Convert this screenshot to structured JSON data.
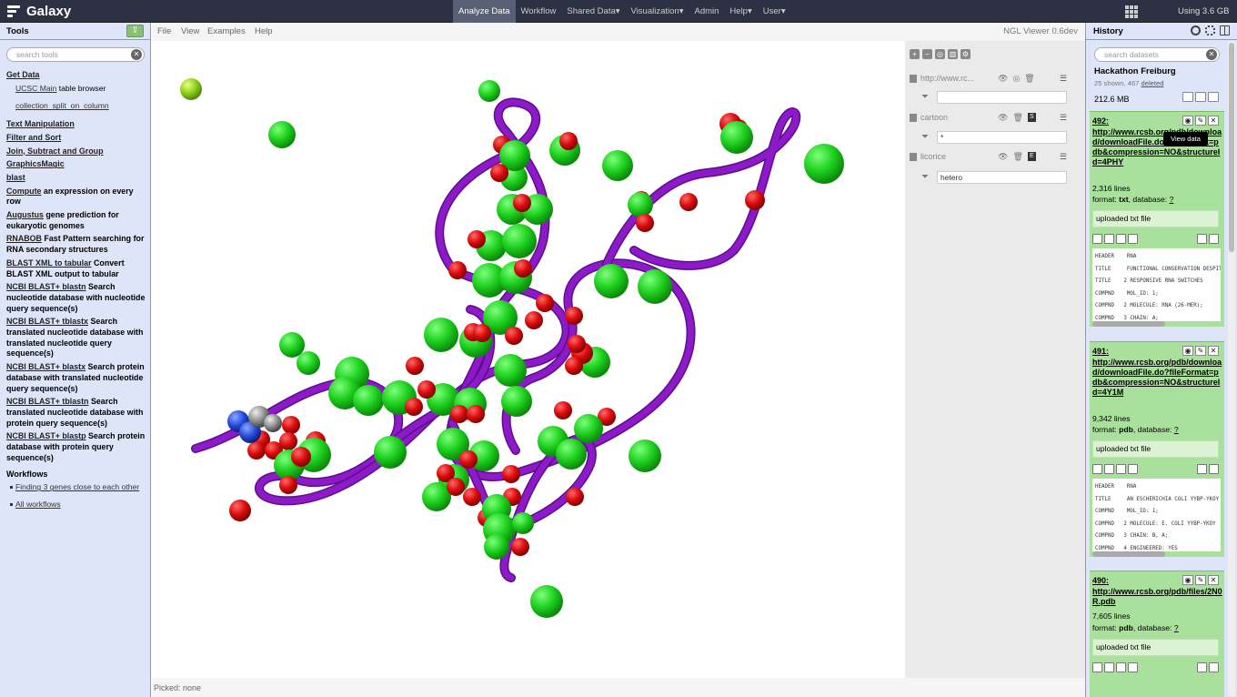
{
  "masthead": {
    "brand": "Galaxy",
    "nav": [
      "Analyze Data",
      "Workflow",
      "Shared Data",
      "Visualization",
      "Admin",
      "Help",
      "User"
    ],
    "quota": "Using 3.6 GB"
  },
  "tools_panel": {
    "title": "Tools",
    "search_placeholder": "search tools",
    "get_data": {
      "label": "Get Data",
      "items": [
        {
          "link": "UCSC Main",
          "rest": " table browser"
        },
        {
          "link": "collection_split_on_column",
          "rest": ""
        }
      ]
    },
    "sections": [
      "Text Manipulation",
      "Filter and Sort",
      "Join, Subtract and Group",
      "GraphicsMagic",
      "blast"
    ],
    "tools": [
      {
        "name": "Compute",
        "desc": " an expression on every row"
      },
      {
        "name": "Augustus",
        "desc": " gene prediction for eukaryotic genomes"
      },
      {
        "name": "RNABOB",
        "desc": " Fast Pattern searching for RNA secondary structures"
      },
      {
        "name": "BLAST XML to tabular",
        "desc": " Convert BLAST XML output to tabular"
      },
      {
        "name": "NCBI BLAST+ blastn",
        "desc": " Search nucleotide database with nucleotide query sequence(s)"
      },
      {
        "name": "NCBI BLAST+ tblastx",
        "desc": " Search translated nucleotide database with translated nucleotide query sequence(s)"
      },
      {
        "name": "NCBI BLAST+ blastx",
        "desc": " Search protein database with translated nucleotide query sequence(s)"
      },
      {
        "name": "NCBI BLAST+ tblastn",
        "desc": " Search translated nucleotide database with protein query sequence(s)"
      },
      {
        "name": "NCBI BLAST+ blastp",
        "desc": " Search protein database with protein query sequence(s)"
      }
    ],
    "workflows_title": "Workflows",
    "workflows": [
      "Finding 3 genes close to each other",
      "All workflows"
    ]
  },
  "center": {
    "menu": [
      "File",
      "View",
      "Examples",
      "Help"
    ],
    "viewer_version": "NGL Viewer 0.6dev",
    "status": "Picked: none",
    "ngl": {
      "components": [
        {
          "name": "http://www.rc...",
          "filter": ""
        },
        {
          "name": "cartoon",
          "letter": "S",
          "filter": "*"
        },
        {
          "name": "licorice",
          "letter": "E",
          "filter": "hetero"
        }
      ]
    }
  },
  "history": {
    "title": "History",
    "search_placeholder": "search datasets",
    "name": "Hackathon Freiburg",
    "shown": "25 shown, 467",
    "deleted_link": "deleted",
    "size": "212.6 MB",
    "tooltip": "View data",
    "datasets": [
      {
        "hid": "492:",
        "url": "http://www.rcsb.org/pdb/download/downloadFile.do?fileFormat=pdb&compression=NO&structureId=4PHY",
        "lines": "2,316 lines",
        "format_label": "format: ",
        "format": "txt",
        "db_label": ", database: ",
        "db": "?",
        "info": "uploaded txt file",
        "peek": [
          "HEADER    RNA",
          "TITLE     FUNCTIONAL CONSERVATION DESPITE",
          "TITLE    2 RESPONSIVE RNA SWITCHES",
          "COMPND    MOL_ID: 1;",
          "COMPND   2 MOLECULE: RNA (26-MER);",
          "COMPND   3 CHAIN: A;"
        ]
      },
      {
        "hid": "491:",
        "url": "http://www.rcsb.org/pdb/download/downloadFile.do?fileFormat=pdb&compression=NO&structureId=4Y1M",
        "lines": "9,342 lines",
        "format_label": "format: ",
        "format": "pdb",
        "db_label": ", database: ",
        "db": "?",
        "info": "uploaded txt file",
        "peek": [
          "HEADER    RNA",
          "TITLE     AN ESCHERICHIA COLI YYBP-YKOY",
          "COMPND    MOL_ID: 1;",
          "COMPND   2 MOLECULE: E. COLI YYBP-YKOY",
          "COMPND   3 CHAIN: B, A;",
          "COMPND   4 ENGINEERED: YES"
        ]
      },
      {
        "hid": "490:",
        "url": "http://www.rcsb.org/pdb/files/2N0R.pdb",
        "lines": "7,605 lines",
        "format_label": "format: ",
        "format": "pdb",
        "db_label": ", database: ",
        "db": "?",
        "info": "uploaded txt file"
      }
    ]
  },
  "colors": {
    "masthead": "#2c3143",
    "panel": "#dfe5f9",
    "dataset_ok": "#a9e09b",
    "ribbon": "#8e19c9",
    "atom_green": "#22d922",
    "atom_red": "#e21010"
  }
}
